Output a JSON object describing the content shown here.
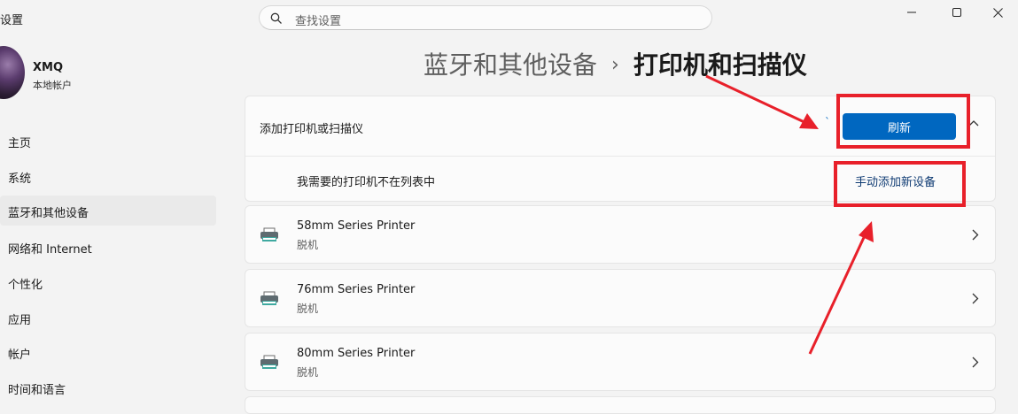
{
  "app": {
    "title": "设置"
  },
  "search": {
    "placeholder": "查找设置"
  },
  "profile": {
    "name": "XMQ",
    "subtitle": "本地帐户"
  },
  "nav": [
    {
      "label": "主页"
    },
    {
      "label": "系统"
    },
    {
      "label": "蓝牙和其他设备",
      "active": true
    },
    {
      "label": "网络和 Internet"
    },
    {
      "label": "个性化"
    },
    {
      "label": "应用"
    },
    {
      "label": "帐户"
    },
    {
      "label": "时间和语言"
    }
  ],
  "breadcrumb": {
    "parent": "蓝牙和其他设备",
    "separator": "›",
    "current": "打印机和扫描仪"
  },
  "add_section": {
    "label": "添加打印机或扫描仪",
    "refresh_label": "刷新",
    "missing_label": "我需要的打印机不在列表中",
    "manual_add_label": "手动添加新设备"
  },
  "printers": [
    {
      "name": "58mm Series Printer",
      "status": "脱机"
    },
    {
      "name": "76mm Series Printer",
      "status": "脱机"
    },
    {
      "name": "80mm Series Printer",
      "status": "脱机"
    }
  ],
  "colors": {
    "accent": "#0067c0",
    "annotation": "#e8202a"
  }
}
